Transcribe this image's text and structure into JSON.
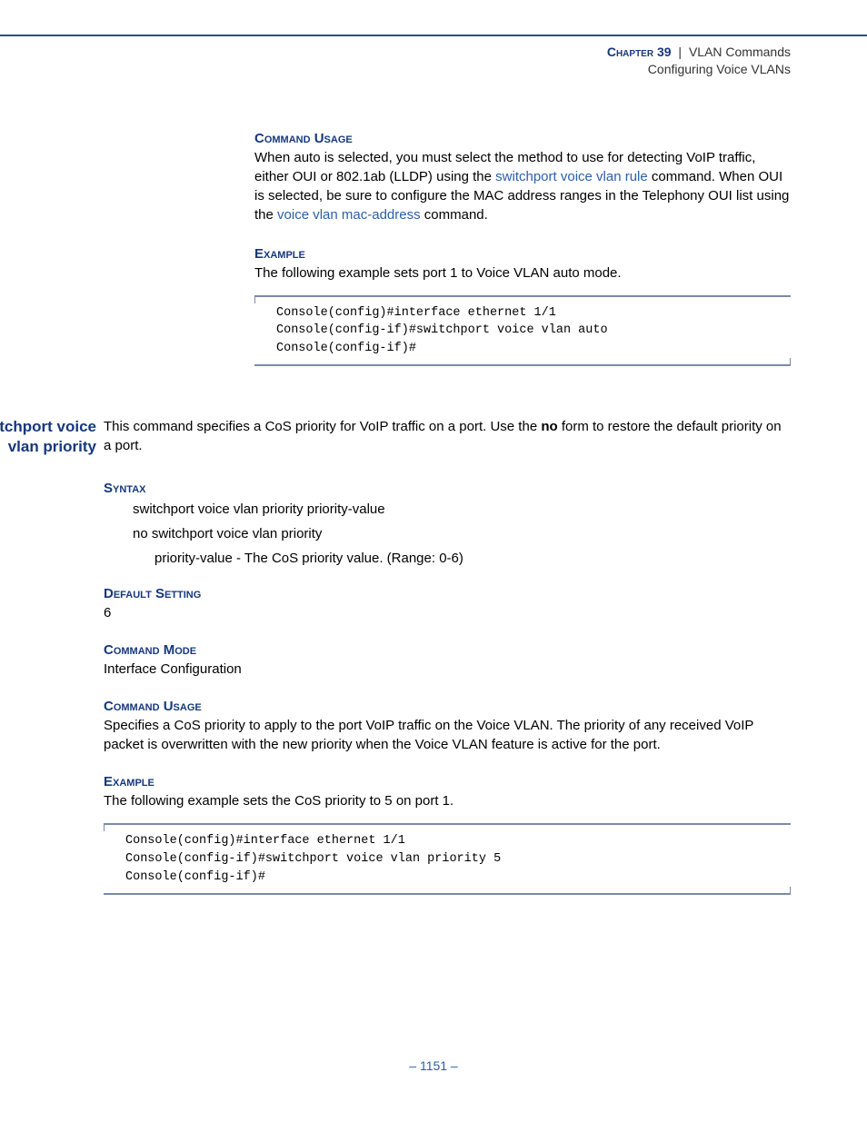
{
  "header": {
    "chapter": "Chapter 39",
    "sep": "|",
    "title": "VLAN Commands",
    "subtitle": "Configuring Voice VLANs"
  },
  "sec1": {
    "head": "Command Usage",
    "p1a_before": "When auto is selected, you must select the method to use for detecting VoIP traffic, either OUI or 802.1ab (LLDP) using the ",
    "p1a_link": "switchport voice vlan rule",
    "p1a_mid": " command. When OUI is selected, be sure to configure the MAC address ranges in the Telephony OUI list using the ",
    "p1a_link2": "voice vlan mac-address",
    "p1a_after": " command."
  },
  "sec2": {
    "head": "Example",
    "p": "The following example sets port 1 to Voice VLAN auto mode.",
    "code": "Console(config)#interface ethernet 1/1\nConsole(config-if)#switchport voice vlan auto\nConsole(config-if)#"
  },
  "cmd": {
    "label_l1": "switchport voice",
    "label_l2": "vlan priority",
    "desc_a": "This command specifies a CoS priority for VoIP traffic on a port. Use the ",
    "desc_no": "no",
    "desc_b": " form to restore the default priority on a port."
  },
  "syntax": {
    "head": "Syntax",
    "line1_bold": "switchport voice vlan priority",
    "line1_ital": " priority-value",
    "line2_bold": "no switchport voice vlan priority",
    "param_name": "priority-value",
    "param_desc": " - The CoS priority value. (Range: 0-6)"
  },
  "defset": {
    "head": "Default Setting",
    "val": "6"
  },
  "cmdmode": {
    "head": "Command Mode",
    "val": "Interface Configuration"
  },
  "usage2": {
    "head": "Command Usage",
    "p": "Specifies a CoS priority to apply to the port VoIP traffic on the Voice VLAN. The priority of any received VoIP packet is overwritten with the new priority when the Voice VLAN feature is active for the port."
  },
  "ex2": {
    "head": "Example",
    "p": "The following example sets the CoS priority to 5 on port 1.",
    "code": "Console(config)#interface ethernet 1/1\nConsole(config-if)#switchport voice vlan priority 5\nConsole(config-if)#"
  },
  "footer": "–  1151  –"
}
